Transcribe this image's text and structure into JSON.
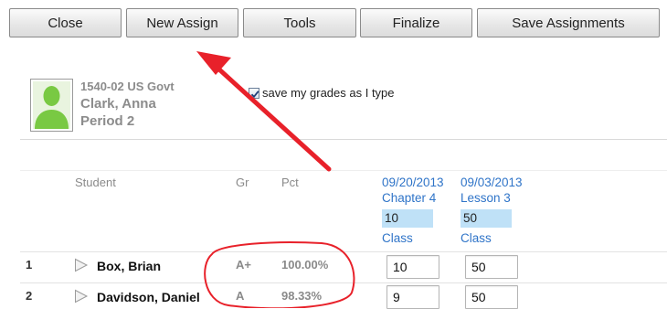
{
  "toolbar": {
    "close_label": "Close",
    "new_assign_label": "New Assign",
    "tools_label": "Tools",
    "finalize_label": "Finalize",
    "save_assignments_label": "Save Assignments"
  },
  "course": {
    "title": "1540-02 US Govt",
    "teacher": "Clark, Anna",
    "period": "Period 2"
  },
  "save_option": {
    "label": "save my grades as I type",
    "checked": true
  },
  "columns": {
    "student": "Student",
    "grade": "Gr",
    "percent": "Pct"
  },
  "assignments": [
    {
      "date": "09/20/2013",
      "name": "Chapter 4",
      "points": "10",
      "type": "Class"
    },
    {
      "date": "09/03/2013",
      "name": "Lesson 3",
      "points": "50",
      "type": "Class"
    }
  ],
  "students": [
    {
      "num": "1",
      "name": "Box, Brian",
      "grade": "A+",
      "pct": "100.00%",
      "scores": [
        "10",
        "50"
      ]
    },
    {
      "num": "2",
      "name": "Davidson, Daniel",
      "grade": "A",
      "pct": "98.33%",
      "scores": [
        "9",
        "50"
      ]
    }
  ],
  "colors": {
    "annotation": "#e8212a",
    "link_blue": "#2f74c8",
    "points_box": "#bfe1f7",
    "avatar_green": "#79c943"
  },
  "icons": {
    "avatar": "person-silhouette-icon",
    "expand": "triangle-right-icon",
    "checkbox": "checkmark-icon"
  }
}
